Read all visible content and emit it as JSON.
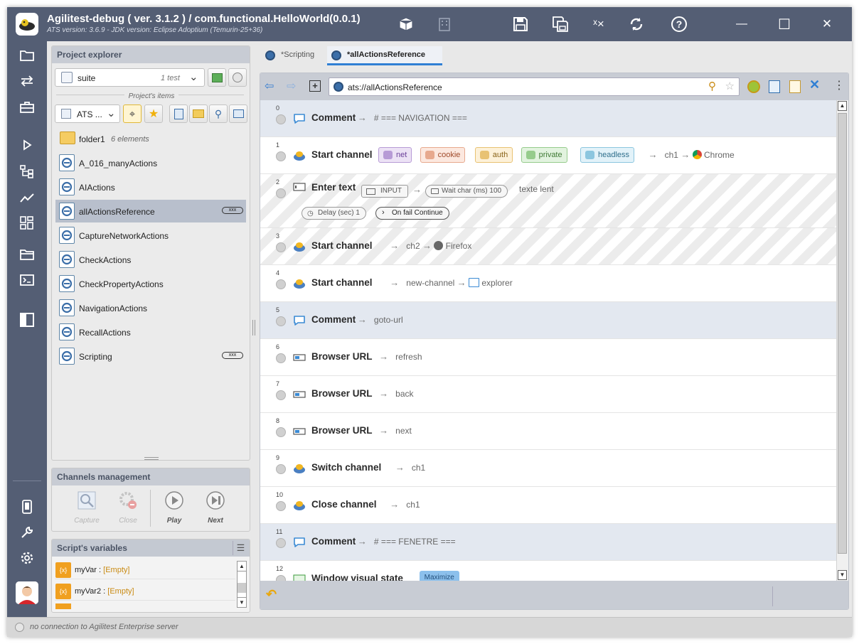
{
  "app": {
    "title": "Agilitest-debug ( ver. 3.1.2 )  /  com.functional.HelloWorld(0.0.1)",
    "subtitle": "ATS version: 3.6.9   -   JDK version: Eclipse Adoptium (Temurin-25+36)"
  },
  "title_buttons": [
    "package-icon",
    "building-icon",
    "save-icon",
    "save-all-icon",
    "clear-variables-icon",
    "refresh-icon",
    "help-icon"
  ],
  "window_controls": {
    "minimize": "—",
    "maximize": "☐",
    "close": "✕"
  },
  "sidebar": {
    "items": [
      "folder-icon",
      "transfer-arrows-icon",
      "toolbox-icon",
      "play-icon",
      "hierarchy-icon",
      "chart-line-icon",
      "dashboard-icon",
      "folder-open-icon",
      "terminal-icon",
      "split-view-icon",
      "mobile-device-icon",
      "wrench-icon",
      "settings-gear-icon"
    ]
  },
  "explorer": {
    "header": "Project explorer",
    "suite_label": "suite",
    "suite_count": "1 test",
    "items_caption": "Project's items",
    "ats_label": "ATS ...",
    "folder": {
      "name": "folder1",
      "count": "6 elements"
    },
    "items": [
      {
        "label": "A_016_manyActions",
        "tag": ""
      },
      {
        "label": "AIActions",
        "tag": ""
      },
      {
        "label": "allActionsReference",
        "tag": "xxx"
      },
      {
        "label": "CaptureNetworkActions",
        "tag": ""
      },
      {
        "label": "CheckActions",
        "tag": ""
      },
      {
        "label": "CheckPropertyActions",
        "tag": ""
      },
      {
        "label": "NavigationActions",
        "tag": ""
      },
      {
        "label": "RecallActions",
        "tag": ""
      },
      {
        "label": "Scripting",
        "tag": "xxx"
      }
    ]
  },
  "channels": {
    "header": "Channels management",
    "buttons": [
      {
        "label": "Capture",
        "enabled": false
      },
      {
        "label": "Close",
        "enabled": false
      },
      {
        "label": "Play",
        "enabled": true
      },
      {
        "label": "Next",
        "enabled": true
      }
    ]
  },
  "variables": {
    "header": "Script's variables",
    "items": [
      {
        "icon": "{x}",
        "name": "myVar",
        "sep": ":",
        "value": "[Empty]"
      },
      {
        "icon": "{x}",
        "name": "myVar2",
        "sep": ":",
        "value": "[Empty]"
      }
    ]
  },
  "tabs": [
    {
      "label": "*Scripting",
      "active": false
    },
    {
      "label": "*allActionsReference",
      "active": true
    }
  ],
  "editor": {
    "url": "ats://allActionsReference"
  },
  "actions": [
    {
      "num": "0",
      "name": "Comment",
      "arrow": "→",
      "detail": "# === NAVIGATION ==="
    },
    {
      "num": "1",
      "name": "Start channel",
      "chips": [
        {
          "label": "net",
          "bg": "#ece2f5",
          "border": "#b79bd6",
          "color": "#6a3f99"
        },
        {
          "label": "cookie",
          "bg": "#fce8df",
          "border": "#e7a98e",
          "color": "#a04a2a"
        },
        {
          "label": "auth",
          "bg": "#fdf1d9",
          "border": "#e8c273",
          "color": "#8a6318"
        },
        {
          "label": "private",
          "bg": "#e2f3df",
          "border": "#96cc8c",
          "color": "#3f7a34"
        },
        {
          "label": "headless",
          "bg": "#e2f2f9",
          "border": "#8cc6df",
          "color": "#2f6f8c"
        }
      ],
      "arrow": "→",
      "channel": "ch1",
      "arrow2": "→",
      "browser": "Chrome"
    },
    {
      "num": "2",
      "name": "Enter text",
      "input": "INPUT",
      "arrow": "→",
      "wait": "Wait char (ms) 100",
      "text": "texte lent",
      "delay": "Delay (sec) 1",
      "onfail": "On fail Continue"
    },
    {
      "num": "3",
      "name": "Start channel",
      "arrow": "→",
      "channel": "ch2",
      "arrow2": "→",
      "browser": "Firefox"
    },
    {
      "num": "4",
      "name": "Start channel",
      "arrow": "→",
      "channel": "new-channel",
      "arrow2": "→",
      "browser": "explorer"
    },
    {
      "num": "5",
      "name": "Comment",
      "arrow": "→",
      "detail": "goto-url"
    },
    {
      "num": "6",
      "name": "Browser URL",
      "arrow": "→",
      "detail": "refresh"
    },
    {
      "num": "7",
      "name": "Browser URL",
      "arrow": "→",
      "detail": "back"
    },
    {
      "num": "8",
      "name": "Browser URL",
      "arrow": "→",
      "detail": "next"
    },
    {
      "num": "9",
      "name": "Switch channel",
      "arrow": "→",
      "detail": "ch1"
    },
    {
      "num": "10",
      "name": "Close channel",
      "arrow": "→",
      "detail": "ch1"
    },
    {
      "num": "11",
      "name": "Comment",
      "arrow": "→",
      "detail": "# === FENETRE ==="
    },
    {
      "num": "12",
      "name": "Window visual state",
      "badge": "Maximize"
    }
  ],
  "status": {
    "text": "no connection to Agilitest Enterprise server"
  }
}
